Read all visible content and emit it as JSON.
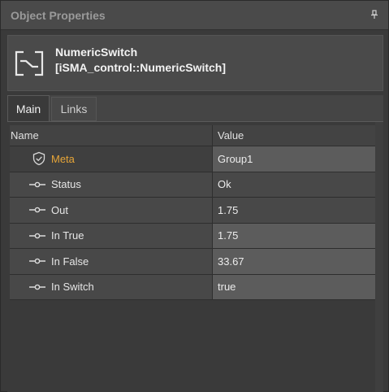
{
  "window": {
    "title": "Object Properties",
    "pin_icon": "pin-icon"
  },
  "component": {
    "icon": "numeric-switch-icon",
    "name": "NumericSwitch",
    "type": "[iSMA_control::NumericSwitch]"
  },
  "tabs": [
    {
      "label": "Main",
      "active": true
    },
    {
      "label": "Links",
      "active": false
    }
  ],
  "grid": {
    "columns": {
      "name": "Name",
      "value": "Value"
    },
    "rows": [
      {
        "icon": "shield-check-icon",
        "name": "Meta",
        "value": "Group1",
        "editable": true,
        "highlight": true
      },
      {
        "icon": "slot-pin-icon",
        "name": "Status",
        "value": "Ok",
        "editable": false
      },
      {
        "icon": "slot-pin-icon",
        "name": "Out",
        "value": "1.75",
        "editable": false
      },
      {
        "icon": "slot-pin-icon",
        "name": "In True",
        "value": "1.75",
        "editable": true
      },
      {
        "icon": "slot-pin-icon",
        "name": "In False",
        "value": "33.67",
        "editable": true
      },
      {
        "icon": "slot-pin-icon",
        "name": "In Switch",
        "value": "true",
        "editable": true
      }
    ]
  },
  "colors": {
    "meta_label": "#e6a538",
    "panel_bg": "#3a3a3a",
    "header_bg": "#4a4a4a"
  }
}
